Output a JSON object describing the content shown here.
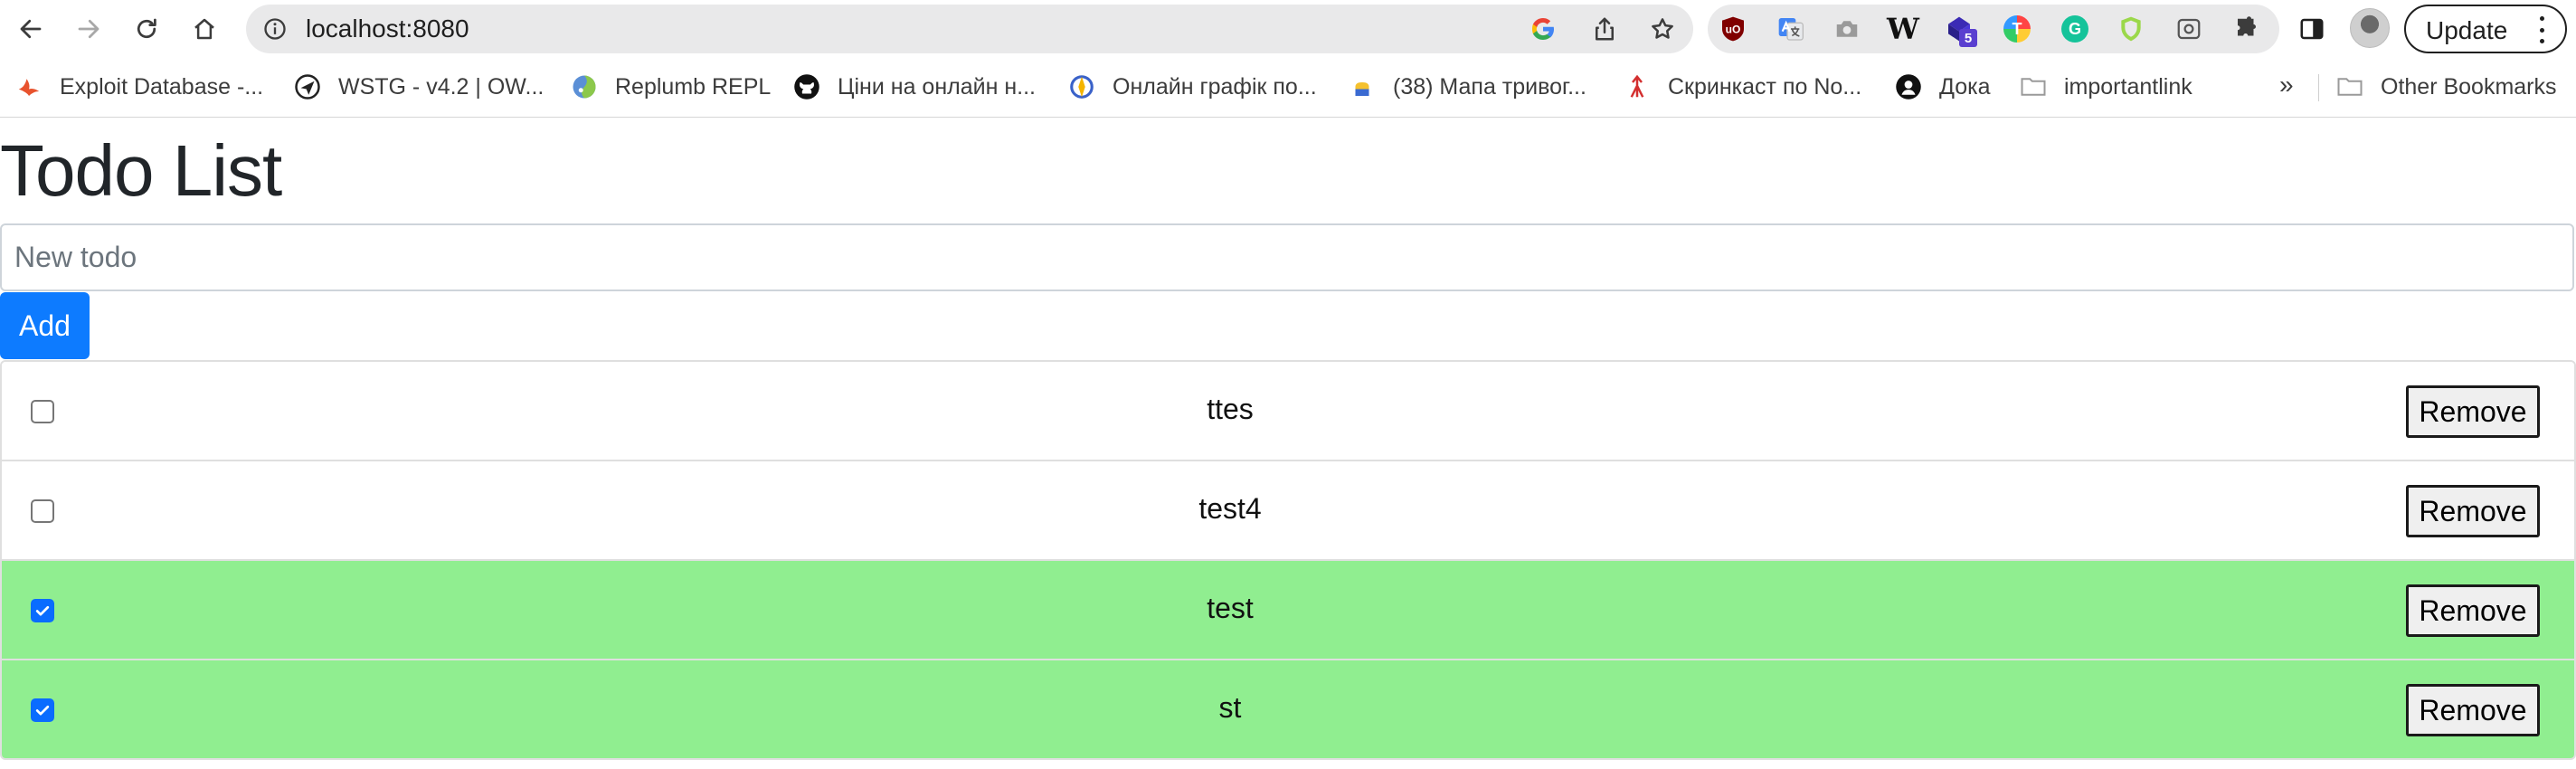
{
  "browser": {
    "url": "localhost:8080",
    "update_label": "Update",
    "extension_badge": "5",
    "extensions": [
      "ublock-icon",
      "google-translate-icon",
      "camera-icon",
      "wikipedia-icon",
      "cube-extension-icon",
      "t-extension-icon",
      "grammarly-icon",
      "shield-extension-icon",
      "screenshot-icon",
      "puzzle-icon"
    ],
    "wikipedia_glyph": "W",
    "t_glyph": "T",
    "grammarly_glyph": "G",
    "ublock_glyph": "uO"
  },
  "bookmarks": {
    "items": [
      {
        "label": "Exploit Database -...",
        "icon": "exploit-db-icon"
      },
      {
        "label": "WSTG - v4.2 | OW...",
        "icon": "wstg-icon"
      },
      {
        "label": "Replumb REPL",
        "icon": "replumb-icon"
      },
      {
        "label": "Ціни на онлайн н...",
        "icon": "github-icon"
      },
      {
        "label": "Онлайн графік по...",
        "icon": "schedule-icon"
      },
      {
        "label": "(38) Мапа тривог...",
        "icon": "alert-map-icon"
      },
      {
        "label": "Скринкаст по No...",
        "icon": "screencast-icon"
      },
      {
        "label": "Дока",
        "icon": "doka-icon"
      },
      {
        "label": "importantlink",
        "icon": "folder-icon"
      }
    ],
    "overflow_label": "»",
    "other_label": "Other Bookmarks"
  },
  "page": {
    "title": "Todo List",
    "input_placeholder": "New todo",
    "input_value": "",
    "add_label": "Add",
    "remove_label": "Remove",
    "done_color": "#90ee90",
    "accent_color": "#0d7bff",
    "todos": [
      {
        "text": "ttes",
        "done": false
      },
      {
        "text": "test4",
        "done": false
      },
      {
        "text": "test",
        "done": true
      },
      {
        "text": "st",
        "done": true
      }
    ]
  }
}
